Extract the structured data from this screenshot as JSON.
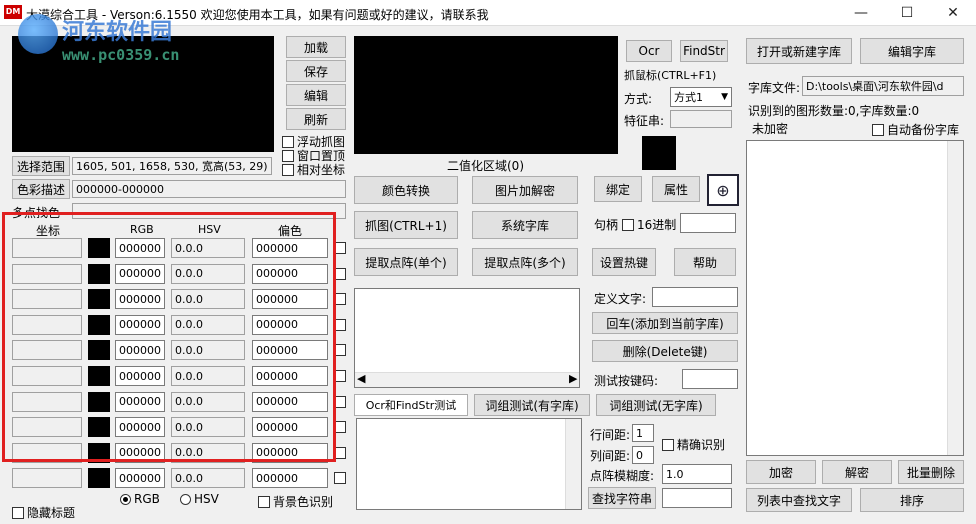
{
  "window": {
    "logo": "DM",
    "title": "大漠综合工具 - Verson:6.1550 欢迎您使用本工具，如果有问题或好的建议，请联系我",
    "minimize": "—",
    "maximize": "☐",
    "close": "✕"
  },
  "watermark": {
    "line1": "河东软件园",
    "line2": "www.pc0359.cn"
  },
  "left_buttons": {
    "load": "加载",
    "save": "保存",
    "edit": "编辑",
    "refresh": "刷新"
  },
  "options": {
    "float_capture": "浮动抓图",
    "window_top": "窗口置顶",
    "relative_coord": "相对坐标"
  },
  "range": {
    "button": "选择范围",
    "value": "1605, 501, 1658, 530, 宽高(53, 29)"
  },
  "color_desc": {
    "button": "色彩描述",
    "value": "000000-000000"
  },
  "multi_pick": {
    "label": "多点找色"
  },
  "table": {
    "headers": {
      "coord": "坐标",
      "rgb": "RGB",
      "hsv": "HSV",
      "offset": "偏色"
    },
    "rows": [
      {
        "rgb": "000000",
        "hsv": "0.0.0",
        "offset": "000000"
      },
      {
        "rgb": "000000",
        "hsv": "0.0.0",
        "offset": "000000"
      },
      {
        "rgb": "000000",
        "hsv": "0.0.0",
        "offset": "000000"
      },
      {
        "rgb": "000000",
        "hsv": "0.0.0",
        "offset": "000000"
      },
      {
        "rgb": "000000",
        "hsv": "0.0.0",
        "offset": "000000"
      },
      {
        "rgb": "000000",
        "hsv": "0.0.0",
        "offset": "000000"
      },
      {
        "rgb": "000000",
        "hsv": "0.0.0",
        "offset": "000000"
      },
      {
        "rgb": "000000",
        "hsv": "0.0.0",
        "offset": "000000"
      },
      {
        "rgb": "000000",
        "hsv": "0.0.0",
        "offset": "000000"
      },
      {
        "rgb": "000000",
        "hsv": "0.0.0",
        "offset": "000000"
      }
    ]
  },
  "bottom_left": {
    "hide_title": "隐藏标题",
    "rgb": "RGB",
    "hsv": "HSV",
    "bg_recognize": "背景色识别"
  },
  "binary_area": {
    "label": "二值化区域(0)"
  },
  "mid_buttons": {
    "color_convert": "颜色转换",
    "image_decrypt": "图片加解密",
    "capture": "抓图(CTRL+1)",
    "system_lib": "系统字库",
    "extract_single": "提取点阵(单个)",
    "extract_multi": "提取点阵(多个)"
  },
  "mid_tabs": {
    "ocr_test": "Ocr和FindStr测试",
    "word_test_lib": "词组测试(有字库)",
    "word_test_nolib": "词组测试(无字库)"
  },
  "right_col": {
    "ocr": "Ocr",
    "findstr": "FindStr",
    "capture_mouse": "抓鼠标(CTRL+F1)",
    "mode_label": "方式:",
    "mode_value": "方式1",
    "feature_label": "特征串:",
    "bind": "绑定",
    "attr": "属性",
    "handle_label": "句柄",
    "hex16": "16进制",
    "set_hotkey": "设置热键",
    "help": "帮助",
    "define_text": "定义文字:",
    "enter_add": "回车(添加到当前字库)",
    "delete": "删除(Delete键)",
    "test_key": "测试按键码:",
    "line_spacing": "行间距:",
    "line_spacing_val": "1",
    "col_spacing": "列间距:",
    "col_spacing_val": "0",
    "precise": "精确识别",
    "blur": "点阵模糊度:",
    "blur_val": "1.0",
    "find_str": "查找字符串"
  },
  "font_lib": {
    "open_create": "打开或新建字库",
    "edit": "编辑字库",
    "file_label": "字库文件:",
    "file_value": "D:\\tools\\桌面\\河东软件园\\d",
    "recognized": "识别到的图形数量:0,字库数量:0",
    "encrypted": "未加密",
    "auto_backup": "自动备份字库",
    "encrypt": "加密",
    "decrypt": "解密",
    "batch_delete": "批量删除",
    "find_in_list": "列表中查找文字",
    "sort": "排序"
  },
  "colors": {
    "highlight": "#e02020",
    "swatch": "#000000"
  }
}
